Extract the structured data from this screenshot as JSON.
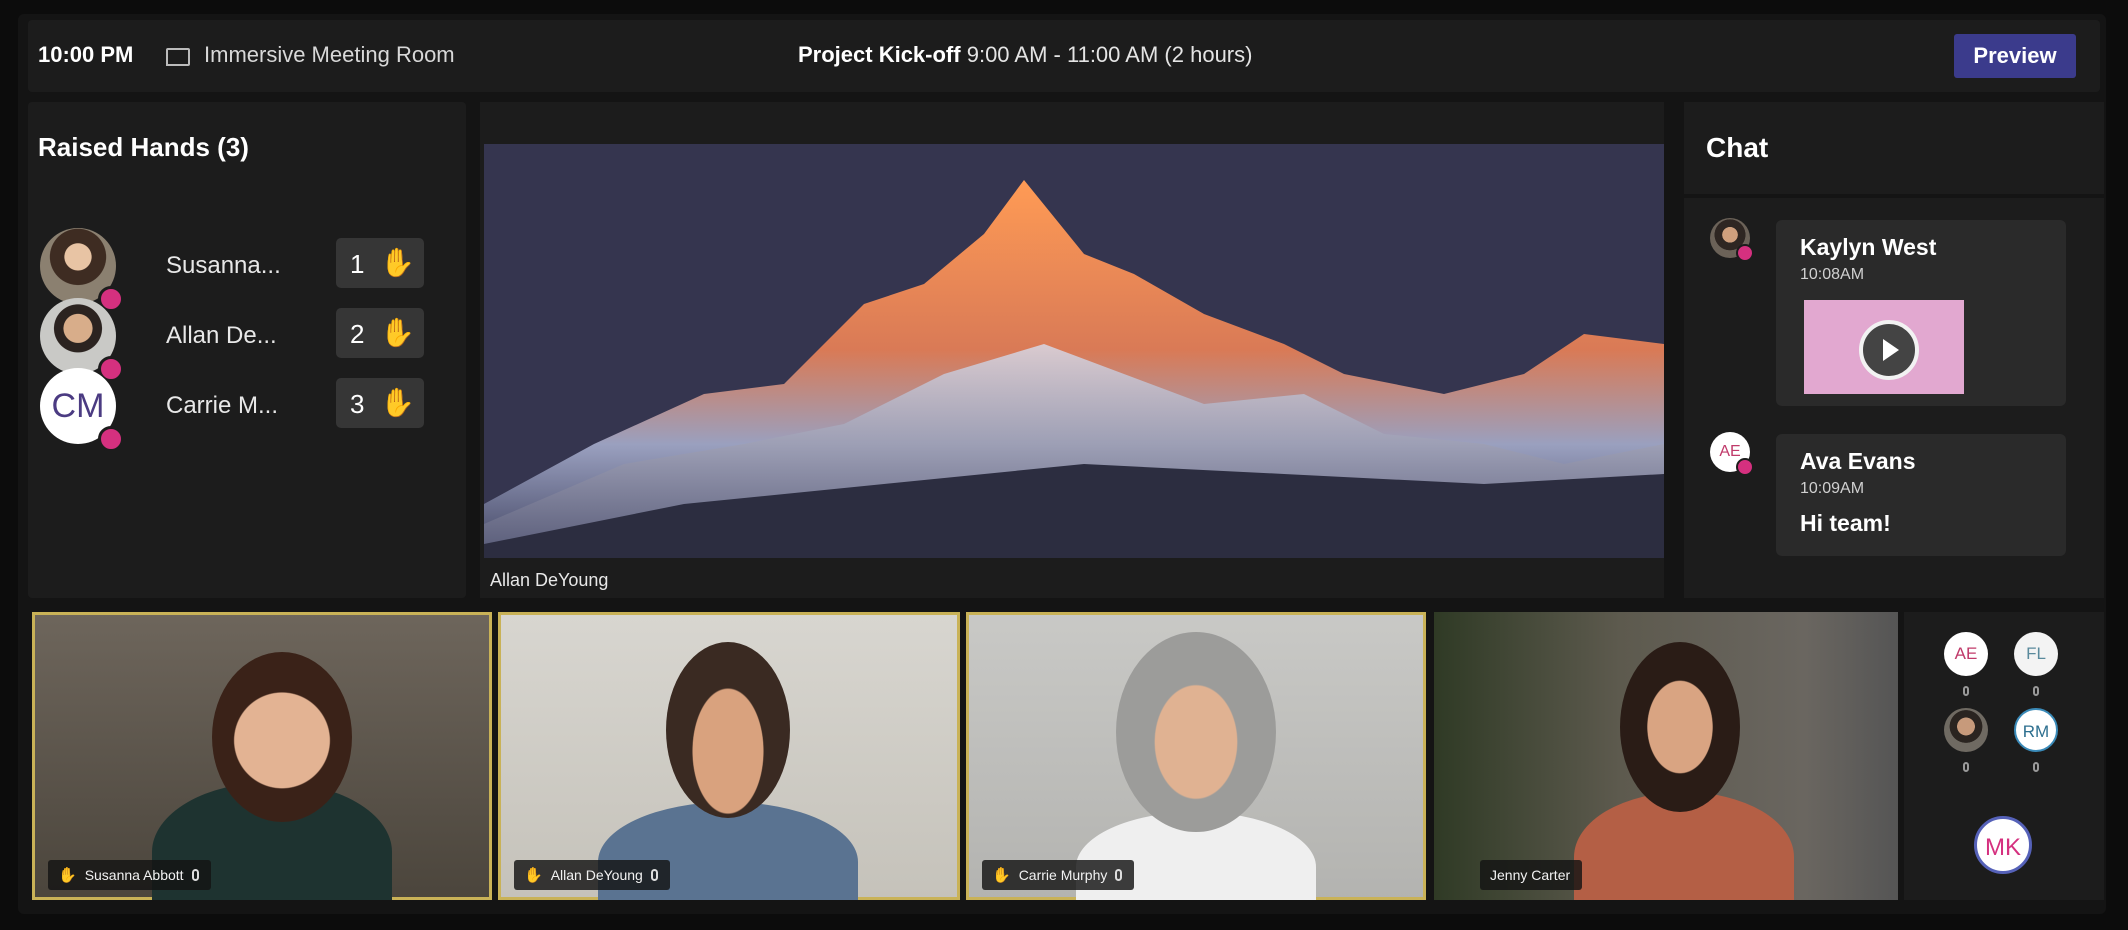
{
  "header": {
    "time": "10:00 PM",
    "room_name": "Immersive Meeting Room",
    "meeting_title": "Project Kick-off",
    "meeting_time": "9:00 AM - 11:00 AM (2 hours)",
    "preview_label": "Preview"
  },
  "raised_hands": {
    "title": "Raised Hands (3)",
    "items": [
      {
        "name": "Susanna...",
        "order": "1"
      },
      {
        "name": "Allan De...",
        "order": "2"
      },
      {
        "name": "Carrie M...",
        "order": "3",
        "initials": "CM"
      }
    ]
  },
  "stage": {
    "presenter": "Allan DeYoung"
  },
  "chat": {
    "title": "Chat",
    "messages": [
      {
        "author": "Kaylyn West",
        "time": "10:08AM",
        "attachment": "gif-video"
      },
      {
        "author": "Ava Evans",
        "initials": "AE",
        "time": "10:09AM",
        "text": "Hi team!"
      }
    ]
  },
  "videos": [
    {
      "name": "Susanna Abbott",
      "hand_raised": true,
      "speaking": true
    },
    {
      "name": "Allan DeYoung",
      "hand_raised": true,
      "speaking": true
    },
    {
      "name": "Carrie Murphy",
      "hand_raised": true,
      "speaking": true
    },
    {
      "name": "Jenny Carter",
      "hand_raised": false,
      "speaking": false
    }
  ],
  "roster": {
    "participants": [
      "AE",
      "FL",
      "RM",
      "MK"
    ]
  },
  "colors": {
    "accent_button": "#3b3b8c",
    "hand": "#f2b634",
    "presence": "#d5307f",
    "speaking_border": "#c9b257"
  }
}
